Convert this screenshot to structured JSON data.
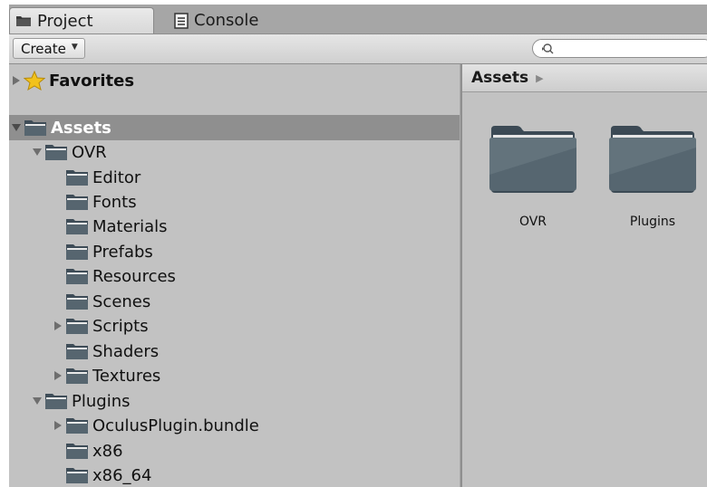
{
  "tabs": {
    "project_label": "Project",
    "console_label": "Console"
  },
  "toolbar": {
    "create_label": "Create",
    "search_placeholder": ""
  },
  "tree": {
    "favorites_label": "Favorites",
    "assets_label": "Assets",
    "ovr_label": "OVR",
    "ovr_children": [
      "Editor",
      "Fonts",
      "Materials",
      "Prefabs",
      "Resources",
      "Scenes",
      "Scripts",
      "Shaders",
      "Textures"
    ],
    "plugins_label": "Plugins",
    "plugins_children": [
      "OculusPlugin.bundle",
      "x86",
      "x86_64"
    ]
  },
  "content": {
    "breadcrumb": "Assets",
    "items": [
      "OVR",
      "Plugins"
    ]
  },
  "colors": {
    "panel_bg": "#c2c2c2",
    "selection": "#8f8f8f",
    "folder_dark": "#4a5a66",
    "folder_light": "#dcdcdc",
    "star": "#f2c21b"
  }
}
